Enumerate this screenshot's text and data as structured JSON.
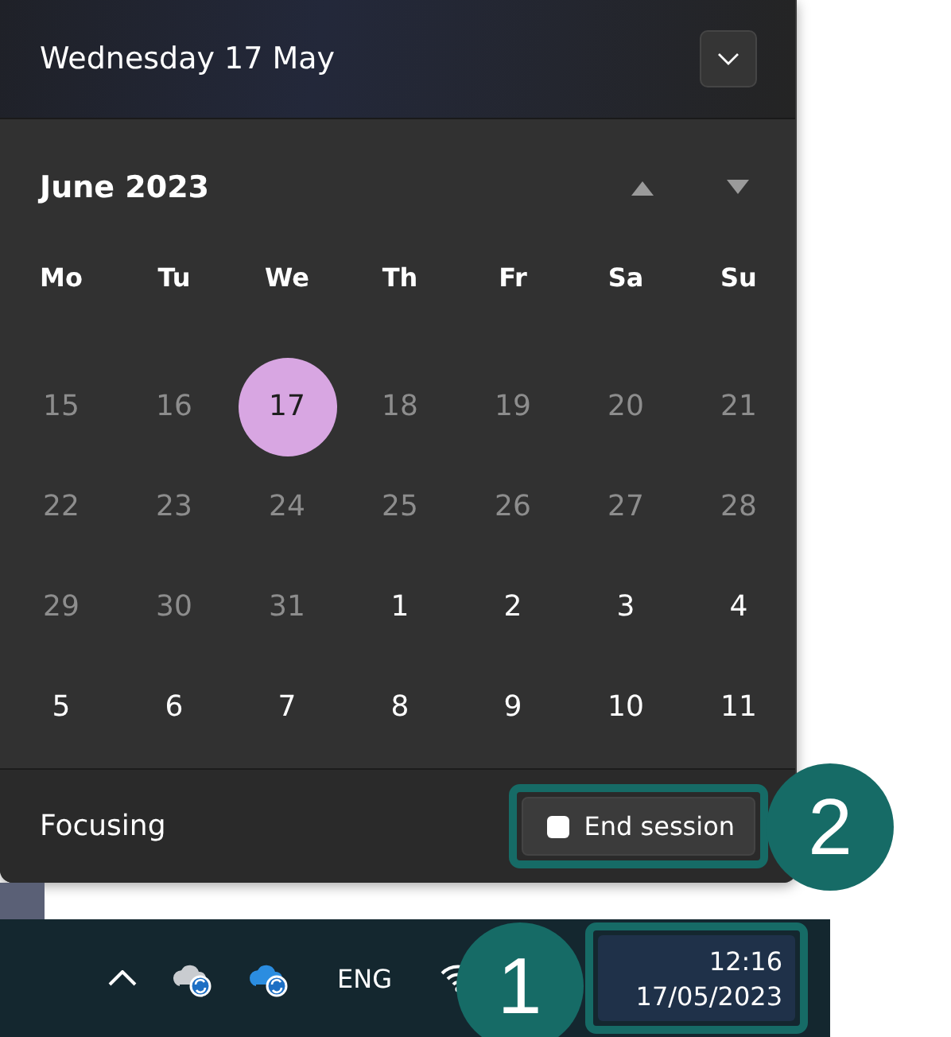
{
  "header": {
    "title": "Wednesday 17 May",
    "expand_button": {
      "expanded": false
    }
  },
  "calendar": {
    "month_label": "June 2023",
    "weekdays": [
      "Mo",
      "Tu",
      "We",
      "Th",
      "Fr",
      "Sa",
      "Su"
    ],
    "days": [
      {
        "label": "15",
        "in_month": false,
        "selected": false
      },
      {
        "label": "16",
        "in_month": false,
        "selected": false
      },
      {
        "label": "17",
        "in_month": false,
        "selected": true
      },
      {
        "label": "18",
        "in_month": false,
        "selected": false
      },
      {
        "label": "19",
        "in_month": false,
        "selected": false
      },
      {
        "label": "20",
        "in_month": false,
        "selected": false
      },
      {
        "label": "21",
        "in_month": false,
        "selected": false
      },
      {
        "label": "22",
        "in_month": false,
        "selected": false
      },
      {
        "label": "23",
        "in_month": false,
        "selected": false
      },
      {
        "label": "24",
        "in_month": false,
        "selected": false
      },
      {
        "label": "25",
        "in_month": false,
        "selected": false
      },
      {
        "label": "26",
        "in_month": false,
        "selected": false
      },
      {
        "label": "27",
        "in_month": false,
        "selected": false
      },
      {
        "label": "28",
        "in_month": false,
        "selected": false
      },
      {
        "label": "29",
        "in_month": false,
        "selected": false
      },
      {
        "label": "30",
        "in_month": false,
        "selected": false
      },
      {
        "label": "31",
        "in_month": false,
        "selected": false
      },
      {
        "label": "1",
        "in_month": true,
        "selected": false
      },
      {
        "label": "2",
        "in_month": true,
        "selected": false
      },
      {
        "label": "3",
        "in_month": true,
        "selected": false
      },
      {
        "label": "4",
        "in_month": true,
        "selected": false
      },
      {
        "label": "5",
        "in_month": true,
        "selected": false
      },
      {
        "label": "6",
        "in_month": true,
        "selected": false
      },
      {
        "label": "7",
        "in_month": true,
        "selected": false
      },
      {
        "label": "8",
        "in_month": true,
        "selected": false
      },
      {
        "label": "9",
        "in_month": true,
        "selected": false
      },
      {
        "label": "10",
        "in_month": true,
        "selected": false
      },
      {
        "label": "11",
        "in_month": true,
        "selected": false
      }
    ]
  },
  "footer": {
    "label": "Focusing",
    "button": {
      "label": "End session",
      "highlighted": true,
      "badge": "2"
    }
  },
  "taskbar": {
    "language": "ENG",
    "clock": {
      "time": "12:16",
      "date": "17/05/2023",
      "highlighted": true,
      "badge": "1"
    }
  }
}
